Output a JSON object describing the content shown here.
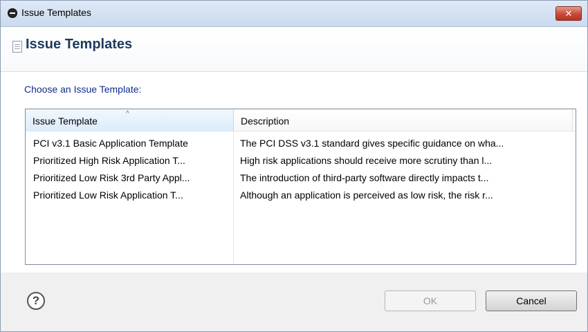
{
  "window": {
    "title": "Issue Templates",
    "close_label": "✕"
  },
  "header": {
    "title": "Issue Templates"
  },
  "main": {
    "prompt": "Choose an Issue Template:",
    "table": {
      "columns": [
        "Issue Template",
        "Description"
      ],
      "sorted_column": "Issue Template",
      "rows": [
        {
          "name": "PCI v3.1 Basic Application Template",
          "description": "The PCI DSS v3.1 standard gives specific guidance on wha..."
        },
        {
          "name": "Prioritized High Risk Application T...",
          "description": "High risk applications should receive more scrutiny than l..."
        },
        {
          "name": "Prioritized Low Risk 3rd Party Appl...",
          "description": "The introduction of third-party software directly impacts t..."
        },
        {
          "name": "Prioritized Low Risk Application T...",
          "description": "Although an application is perceived as low risk, the risk r..."
        }
      ]
    }
  },
  "footer": {
    "help_glyph": "?",
    "ok_label": "OK",
    "cancel_label": "Cancel"
  },
  "icons": {
    "app": "eclipse-app-icon",
    "header": "document-icon",
    "help": "help-icon",
    "sort": "sort-ascending-icon"
  },
  "colors": {
    "prompt_text": "#102c8c",
    "header_title": "#1d3a5c",
    "close_button": "#c8493a"
  }
}
